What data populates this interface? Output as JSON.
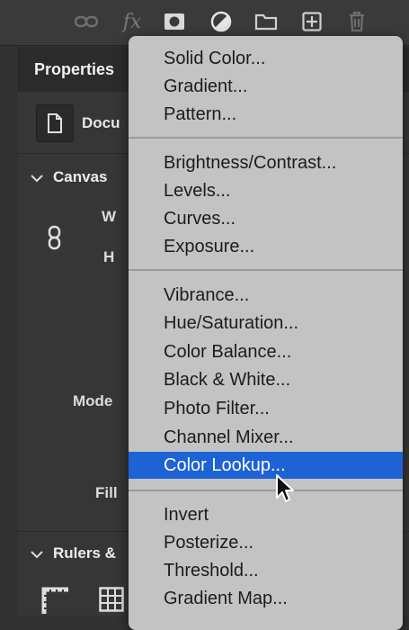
{
  "toolbar": {
    "icons": [
      "link-icon",
      "fx-icon",
      "mask-icon",
      "adjustment-icon",
      "folder-icon",
      "new-layer-icon",
      "trash-icon"
    ],
    "fx_label": "fx"
  },
  "properties": {
    "title": "Properties",
    "doc_label": "Docu",
    "canvas_label": "Canvas",
    "w_label": "W",
    "h_label": "H",
    "mode_label": "Mode",
    "fill_label": "Fill",
    "rulers_label": "Rulers &"
  },
  "menu": {
    "group1": [
      "Solid Color...",
      "Gradient...",
      "Pattern..."
    ],
    "group2": [
      "Brightness/Contrast...",
      "Levels...",
      "Curves...",
      "Exposure..."
    ],
    "group3": [
      "Vibrance...",
      "Hue/Saturation...",
      "Color Balance...",
      "Black & White...",
      "Photo Filter...",
      "Channel Mixer...",
      "Color Lookup..."
    ],
    "group4": [
      "Invert",
      "Posterize...",
      "Threshold...",
      "Gradient Map..."
    ],
    "highlighted": "Color Lookup..."
  },
  "colors": {
    "menu_bg": "#c3c3c3",
    "highlight": "#1e63d6",
    "panel_bg": "#363636"
  }
}
